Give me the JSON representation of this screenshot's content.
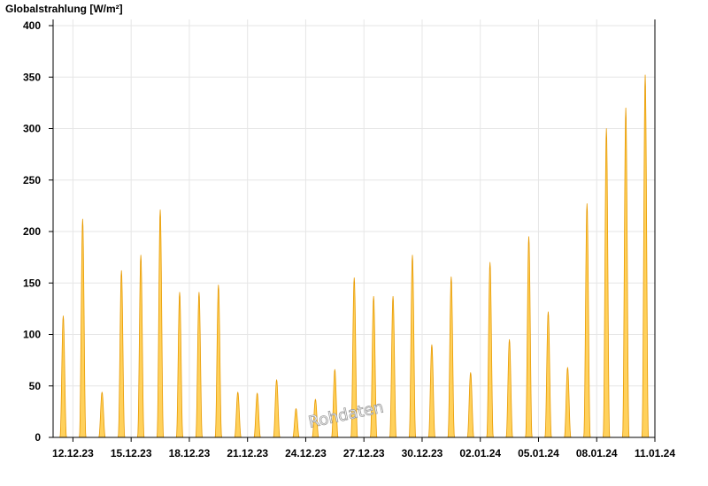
{
  "chart_data": {
    "type": "area",
    "title": "Globalstrahlung [W/m²]",
    "xlabel": "",
    "ylabel": "",
    "ylim": [
      0,
      400
    ],
    "yticks": [
      0,
      50,
      100,
      150,
      200,
      250,
      300,
      350,
      400
    ],
    "xlim": [
      "2023-12-11",
      "2024-01-11"
    ],
    "xticks": [
      "12.12.23",
      "15.12.23",
      "18.12.23",
      "21.12.23",
      "24.12.23",
      "27.12.23",
      "30.12.23",
      "02.01.24",
      "05.01.24",
      "08.01.24",
      "11.01.24"
    ],
    "grid": true,
    "legend": "none",
    "watermark": "Rohdaten",
    "colors": {
      "fill": "#ffd15c",
      "stroke": "#e89a00",
      "axis": "#000000",
      "grid": "#e6e6e6"
    },
    "series": [
      {
        "values": [
          {
            "date": "2023-12-11",
            "peak": 118
          },
          {
            "date": "2023-12-12",
            "peak": 212
          },
          {
            "date": "2023-12-13",
            "peak": 44
          },
          {
            "date": "2023-12-14",
            "peak": 162
          },
          {
            "date": "2023-12-15",
            "peak": 177
          },
          {
            "date": "2023-12-16",
            "peak": 221
          },
          {
            "date": "2023-12-17",
            "peak": 141
          },
          {
            "date": "2023-12-18",
            "peak": 141
          },
          {
            "date": "2023-12-19",
            "peak": 148
          },
          {
            "date": "2023-12-20",
            "peak": 44
          },
          {
            "date": "2023-12-21",
            "peak": 43
          },
          {
            "date": "2023-12-22",
            "peak": 56
          },
          {
            "date": "2023-12-23",
            "peak": 28
          },
          {
            "date": "2023-12-24",
            "peak": 37
          },
          {
            "date": "2023-12-25",
            "peak": 66
          },
          {
            "date": "2023-12-26",
            "peak": 155
          },
          {
            "date": "2023-12-27",
            "peak": 137
          },
          {
            "date": "2023-12-28",
            "peak": 137
          },
          {
            "date": "2023-12-29",
            "peak": 177
          },
          {
            "date": "2023-12-30",
            "peak": 90
          },
          {
            "date": "2023-12-31",
            "peak": 156
          },
          {
            "date": "2024-01-01",
            "peak": 63
          },
          {
            "date": "2024-01-02",
            "peak": 170
          },
          {
            "date": "2024-01-03",
            "peak": 95
          },
          {
            "date": "2024-01-04",
            "peak": 195
          },
          {
            "date": "2024-01-05",
            "peak": 122
          },
          {
            "date": "2024-01-06",
            "peak": 68
          },
          {
            "date": "2024-01-07",
            "peak": 227
          },
          {
            "date": "2024-01-08",
            "peak": 300
          },
          {
            "date": "2024-01-09",
            "peak": 320
          },
          {
            "date": "2024-01-10",
            "peak": 352
          }
        ]
      }
    ]
  }
}
